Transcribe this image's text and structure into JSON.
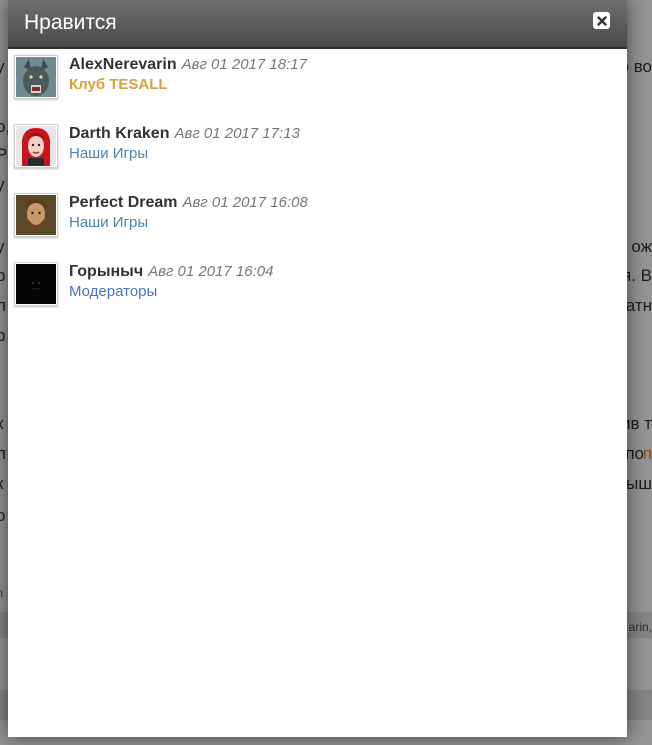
{
  "modal": {
    "title": "Нравится",
    "close_label": "close"
  },
  "likes": [
    {
      "name": "AlexNerevarin",
      "date": "Авг 01 2017 18:17",
      "group": "Клуб TESALL",
      "group_color": "#d8a13c",
      "avatar": "werewolf-avatar"
    },
    {
      "name": "Darth Kraken",
      "date": "Авг 01 2017 17:13",
      "group": "Наши Игры",
      "group_color": "#4c84ad",
      "avatar": "red-hair-girl-avatar"
    },
    {
      "name": "Perfect Dream",
      "date": "Авг 01 2017 16:08",
      "group": "Наши Игры",
      "group_color": "#4c84ad",
      "avatar": "bearded-man-avatar"
    },
    {
      "name": "Горыныч",
      "date": "Авг 01 2017 16:04",
      "group": "Модераторы",
      "group_color": "#4a72c9",
      "avatar": "dark-avatar"
    }
  ],
  "background": {
    "fragments_right": [
      "о во",
      "о ож",
      "я. В",
      "атн",
      "ив т",
      "по",
      "ыш",
      "arin,"
    ],
    "fragments_left": [
      "у",
      "о,",
      "Р",
      "у",
      "у",
      "р",
      "л",
      "р",
      "к",
      "л",
      "к",
      "о",
      "л"
    ],
    "orange_fragment": "п"
  },
  "colors": {
    "header": "#5c5c5c",
    "gold": "#d8a13c",
    "blue": "#4c84ad",
    "moderators": "#4a72c9"
  }
}
